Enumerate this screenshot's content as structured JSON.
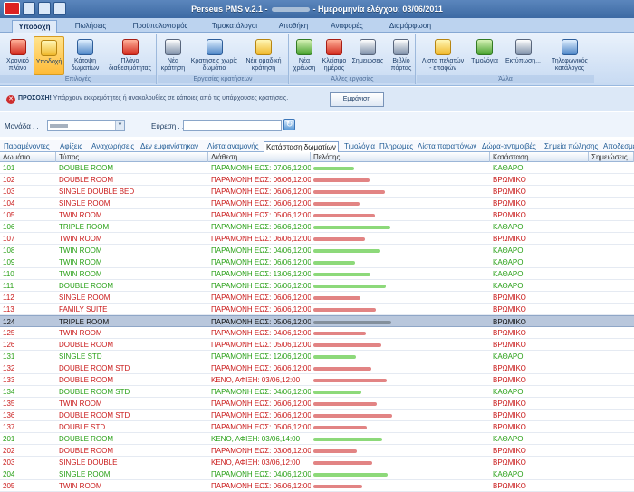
{
  "window": {
    "title_prefix": "Perseus PMS v.2.1 -",
    "title_suffix": "- Ημερομηνία ελέγχου: 03/06/2011"
  },
  "tabs": [
    "Υποδοχή",
    "Πωλήσεις",
    "Προϋπολογισμός",
    "Τιμοκατάλογοι",
    "Αποθήκη",
    "Αναφορές",
    "Διαμόρφωση"
  ],
  "ribbon": {
    "groups": [
      "Επιλογές",
      "Εργασίες κρατήσεων",
      "Άλλες εργασίες",
      "Άλλα"
    ],
    "buttons": [
      "Χρονικό πλάνο",
      "Υποδοχή",
      "Κάτοψη δωματίων",
      "Πλάνο διαθεσιμότητας",
      "Νέα κράτηση",
      "Κρατήσεις χωρίς δωμάτιο",
      "Νέα ομαδική κράτηση",
      "Νέα χρέωση",
      "Κλείσιμο ημέρας",
      "Σημειώσεις",
      "Βιβλίο πόρτας",
      "Λίστα πελατών - επαφών",
      "Τιμολόγια",
      "Εκτύπωση...",
      "Τηλεφωνικός κατάλογος"
    ]
  },
  "notice": {
    "title": "ΠΡΟΣΟΧΗ!",
    "message": "Υπάρχουν εκκρεμότητες ή ανακολουθίες σε κάποιες από τις υπάρχουσες κρατήσεις.",
    "button": "Εμφάνιση"
  },
  "filters": {
    "unit_label": "Μονάδα . .",
    "search_label": "Εύρεση . .",
    "search_value": ""
  },
  "subtabs": [
    "Παραμένοντες",
    "Αφίξεις",
    "Αναχωρήσεις",
    "Δεν εμφανίστηκαν",
    "Λίστα αναμονής",
    "Κατάσταση δωματίων",
    "Τιμολόγια",
    "Πληρωμές",
    "Λίστα παραπόνων",
    "Δώρα-αντιμοιβές",
    "Σημεία πώλησης",
    "Αποδεσμεύσεις"
  ],
  "table": {
    "headers": [
      "Δωμάτιο",
      "Τύπος",
      "Διάθεση",
      "Πελάτης",
      "Κατάσταση",
      "Σημειώσεις"
    ],
    "rows": [
      [
        "101",
        "DOUBLE ROOM",
        "ΠΑΡΑΜΟΝΗ ΕΩΣ: 07/06,12:00",
        "ΚΑΘΑΡΟ",
        "green"
      ],
      [
        "102",
        "DOUBLE ROOM",
        "ΠΑΡΑΜΟΝΗ ΕΩΣ: 06/06,12:00",
        "ΒΡΩΜΙΚΟ",
        "red"
      ],
      [
        "103",
        "SINGLE DOUBLE BED",
        "ΠΑΡΑΜΟΝΗ ΕΩΣ: 06/06,12:00",
        "ΒΡΩΜΙΚΟ",
        "red"
      ],
      [
        "104",
        "SINGLE ROOM",
        "ΠΑΡΑΜΟΝΗ ΕΩΣ: 06/06,12:00",
        "ΒΡΩΜΙΚΟ",
        "red"
      ],
      [
        "105",
        "TWIN ROOM",
        "ΠΑΡΑΜΟΝΗ ΕΩΣ: 05/06,12:00",
        "ΒΡΩΜΙΚΟ",
        "red"
      ],
      [
        "106",
        "TRIPLE ROOM",
        "ΠΑΡΑΜΟΝΗ ΕΩΣ: 06/06,12:00",
        "ΚΑΘΑΡΟ",
        "green"
      ],
      [
        "107",
        "TWIN ROOM",
        "ΠΑΡΑΜΟΝΗ ΕΩΣ: 06/06,12:00",
        "ΒΡΩΜΙΚΟ",
        "red"
      ],
      [
        "108",
        "TWIN ROOM",
        "ΠΑΡΑΜΟΝΗ ΕΩΣ: 04/06,12:00",
        "ΚΑΘΑΡΟ",
        "green"
      ],
      [
        "109",
        "TWIN ROOM",
        "ΠΑΡΑΜΟΝΗ ΕΩΣ: 06/06,12:00",
        "ΚΑΘΑΡΟ",
        "green"
      ],
      [
        "110",
        "TWIN ROOM",
        "ΠΑΡΑΜΟΝΗ ΕΩΣ: 13/06,12:00",
        "ΚΑΘΑΡΟ",
        "green"
      ],
      [
        "111",
        "DOUBLE ROOM",
        "ΠΑΡΑΜΟΝΗ ΕΩΣ: 06/06,12:00",
        "ΚΑΘΑΡΟ",
        "green"
      ],
      [
        "112",
        "SINGLE ROOM",
        "ΠΑΡΑΜΟΝΗ ΕΩΣ: 06/06,12:00",
        "ΒΡΩΜΙΚΟ",
        "red"
      ],
      [
        "113",
        "FAMILY SUITE",
        "ΠΑΡΑΜΟΝΗ ΕΩΣ: 06/06,12:00",
        "ΒΡΩΜΙΚΟ",
        "red"
      ],
      [
        "124",
        "TRIPLE ROOM",
        "ΠΑΡΑΜΟΝΗ ΕΩΣ: 05/06,12:00",
        "ΒΡΩΜΙΚΟ",
        "sel"
      ],
      [
        "125",
        "TWIN ROOM",
        "ΠΑΡΑΜΟΝΗ ΕΩΣ: 04/06,12:00",
        "ΒΡΩΜΙΚΟ",
        "red"
      ],
      [
        "126",
        "DOUBLE ROOM",
        "ΠΑΡΑΜΟΝΗ ΕΩΣ: 05/06,12:00",
        "ΒΡΩΜΙΚΟ",
        "red"
      ],
      [
        "131",
        "SINGLE STD",
        "ΠΑΡΑΜΟΝΗ ΕΩΣ: 12/06,12:00",
        "ΚΑΘΑΡΟ",
        "green"
      ],
      [
        "132",
        "DOUBLE ROOM STD",
        "ΠΑΡΑΜΟΝΗ ΕΩΣ: 06/06,12:00",
        "ΒΡΩΜΙΚΟ",
        "red"
      ],
      [
        "133",
        "DOUBLE ROOM",
        "ΚΕΝΟ, ΑΦΙΞΗ: 03/06,12:00",
        "ΒΡΩΜΙΚΟ",
        "red"
      ],
      [
        "134",
        "DOUBLE ROOM STD",
        "ΠΑΡΑΜΟΝΗ ΕΩΣ: 04/06,12:00",
        "ΚΑΘΑΡΟ",
        "green"
      ],
      [
        "135",
        "TWIN ROOM",
        "ΠΑΡΑΜΟΝΗ ΕΩΣ: 06/06,12:00",
        "ΒΡΩΜΙΚΟ",
        "red"
      ],
      [
        "136",
        "DOUBLE ROOM STD",
        "ΠΑΡΑΜΟΝΗ ΕΩΣ: 06/06,12:00",
        "ΒΡΩΜΙΚΟ",
        "red"
      ],
      [
        "137",
        "DOUBLE STD",
        "ΠΑΡΑΜΟΝΗ ΕΩΣ: 05/06,12:00",
        "ΒΡΩΜΙΚΟ",
        "red"
      ],
      [
        "201",
        "DOUBLE ROOM",
        "ΚΕΝΟ, ΑΦΙΞΗ: 03/06,14:00",
        "ΚΑΘΑΡΟ",
        "green"
      ],
      [
        "202",
        "DOUBLE ROOM",
        "ΠΑΡΑΜΟΝΗ ΕΩΣ: 03/06,12:00",
        "ΒΡΩΜΙΚΟ",
        "red"
      ],
      [
        "203",
        "SINGLE DOUBLE",
        "ΚΕΝΟ, ΑΦΙΞΗ: 03/06,12:00",
        "ΒΡΩΜΙΚΟ",
        "red"
      ],
      [
        "204",
        "SINGLE ROOM",
        "ΠΑΡΑΜΟΝΗ ΕΩΣ: 04/06,12:00",
        "ΚΑΘΑΡΟ",
        "green"
      ],
      [
        "205",
        "TWIN ROOM",
        "ΠΑΡΑΜΟΝΗ ΕΩΣ: 06/06,12:00",
        "ΒΡΩΜΙΚΟ",
        "red"
      ]
    ]
  }
}
